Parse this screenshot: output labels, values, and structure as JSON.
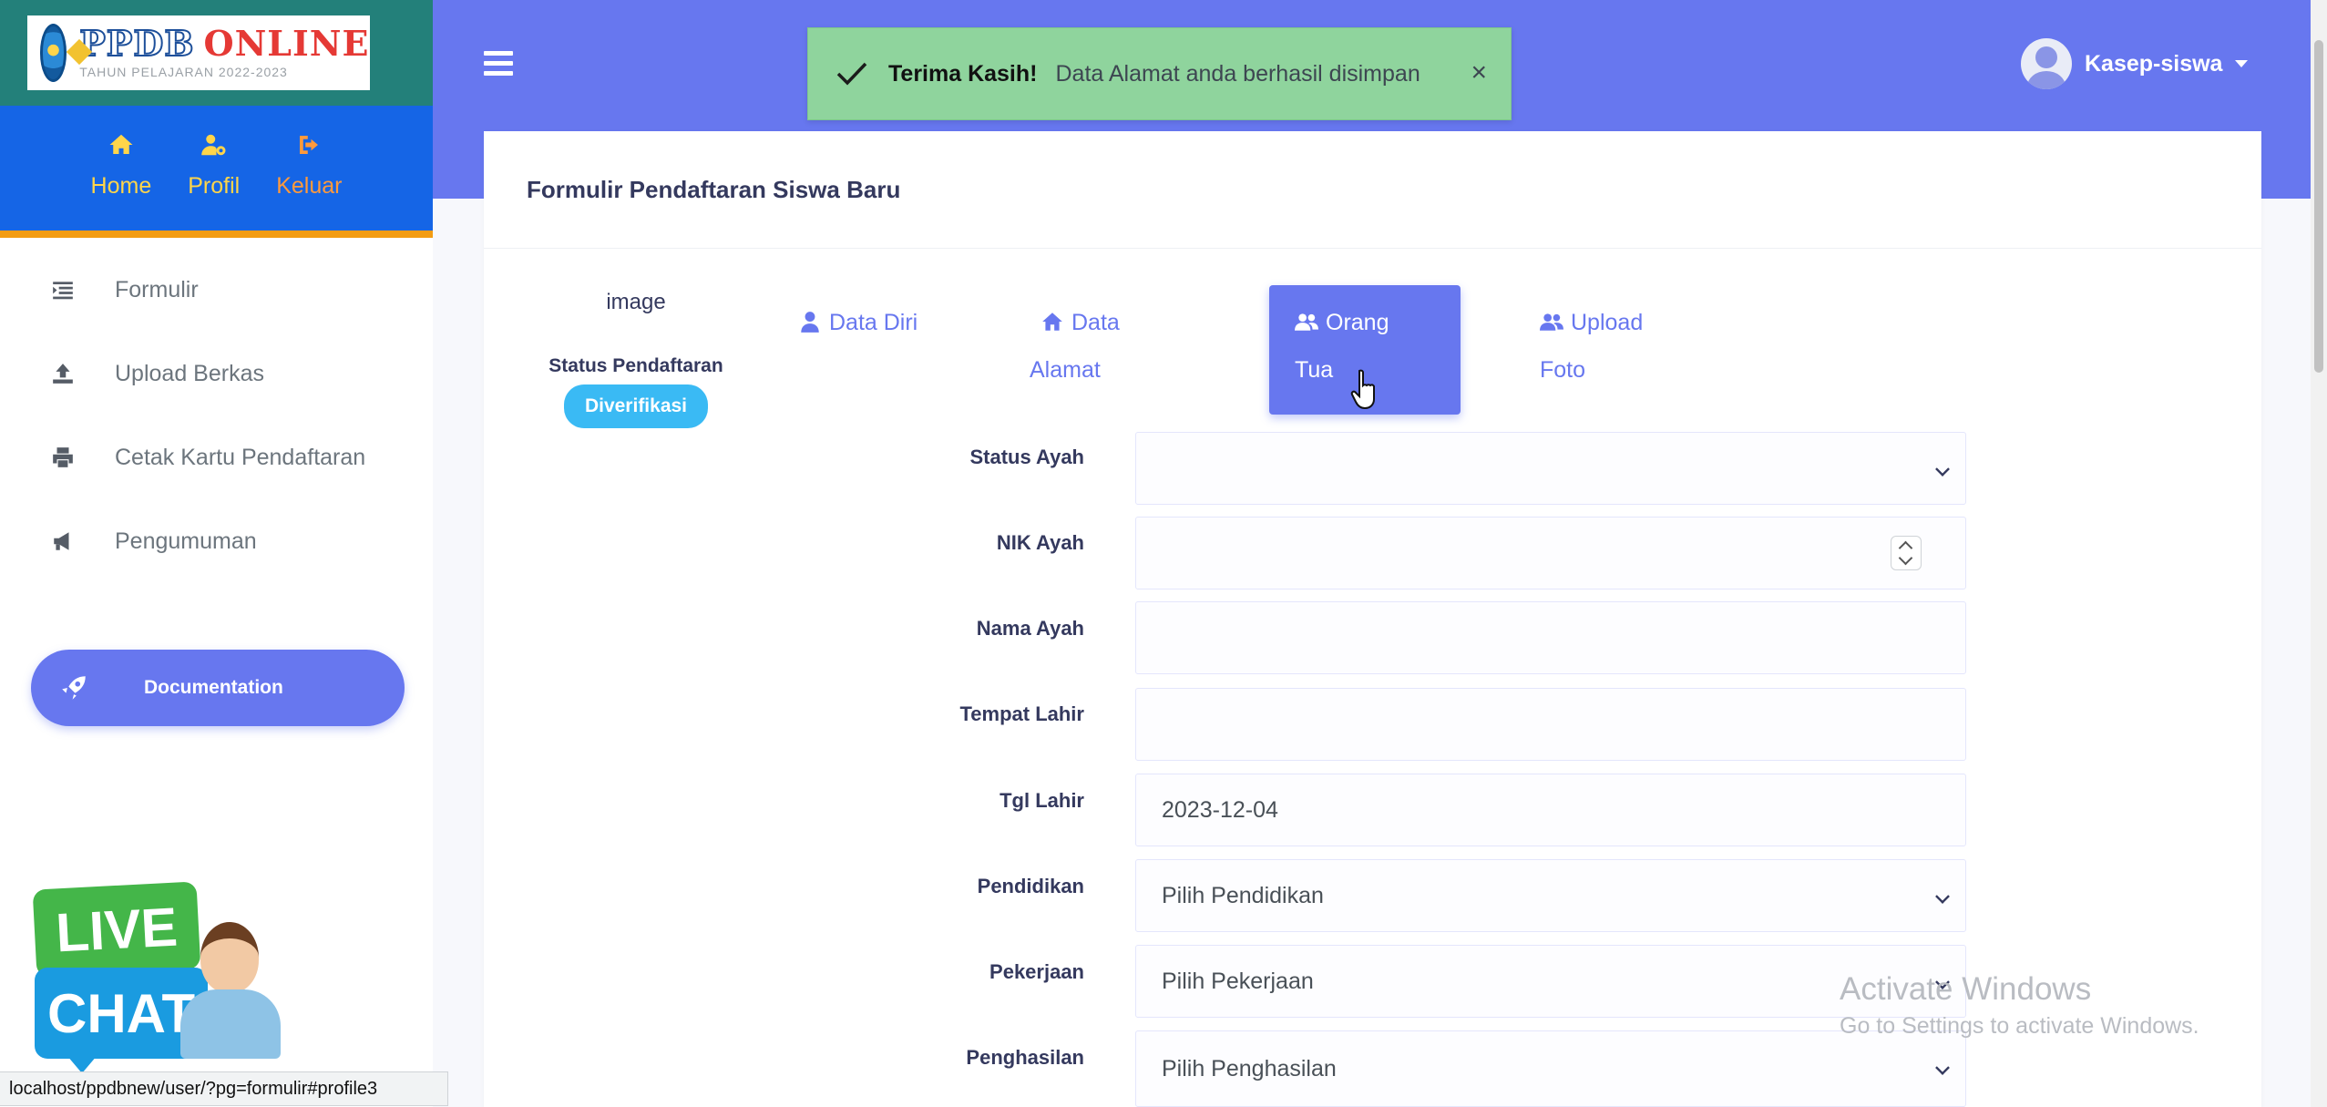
{
  "brand": {
    "title_ppdb": "PPDB",
    "title_online": "ONLINE",
    "subtitle": "TAHUN PELAJARAN 2022-2023"
  },
  "quick_links": [
    {
      "label": "Home",
      "icon": "home-icon"
    },
    {
      "label": "Profil",
      "icon": "user-cog-icon"
    },
    {
      "label": "Keluar",
      "icon": "sign-out-icon"
    }
  ],
  "menu": [
    {
      "label": "Formulir",
      "icon": "list-icon"
    },
    {
      "label": "Upload Berkas",
      "icon": "upload-icon"
    },
    {
      "label": "Cetak Kartu Pendaftaran",
      "icon": "print-icon"
    },
    {
      "label": "Pengumuman",
      "icon": "megaphone-icon"
    }
  ],
  "documentation": {
    "label": "Documentation",
    "icon": "rocket-icon"
  },
  "livechat": {
    "line1": "LIVE",
    "line2": "CHAT"
  },
  "status_bar": {
    "url": "localhost/ppdbnew/user/?pg=formulir#profile3"
  },
  "toast": {
    "strong": "Terima Kasih!",
    "message": "Data Alamat anda berhasil disimpan",
    "close": "×",
    "color": "#8fd49d"
  },
  "user": {
    "name": "Kasep-siswa"
  },
  "card": {
    "title": "Formulir Pendaftaran Siswa Baru"
  },
  "profile": {
    "image_alt": "image",
    "status_label": "Status Pendaftaran",
    "status_badge": "Diverifikasi"
  },
  "tabs": [
    {
      "line1": "Data Diri",
      "line2": "",
      "icon": "user-icon",
      "active": false
    },
    {
      "line1": "Data",
      "line2": "Alamat",
      "icon": "home-icon",
      "active": false
    },
    {
      "line1": "Orang",
      "line2": "Tua",
      "icon": "users-icon",
      "active": true
    },
    {
      "line1": "Upload",
      "line2": "Foto",
      "icon": "users-icon",
      "active": false
    }
  ],
  "form": {
    "status_ayah": {
      "label": "Status Ayah",
      "value": ""
    },
    "nik_ayah": {
      "label": "NIK Ayah",
      "value": ""
    },
    "nama_ayah": {
      "label": "Nama Ayah",
      "value": ""
    },
    "tempat_lahir": {
      "label": "Tempat Lahir",
      "value": ""
    },
    "tgl_lahir": {
      "label": "Tgl Lahir",
      "value": "2023-12-04"
    },
    "pendidikan": {
      "label": "Pendidikan",
      "value": "Pilih Pendidikan"
    },
    "pekerjaan": {
      "label": "Pekerjaan",
      "value": "Pilih Pekerjaan"
    },
    "penghasilan": {
      "label": "Penghasilan",
      "value": "Pilih Penghasilan"
    }
  },
  "windows_watermark": {
    "title": "Activate Windows",
    "subtitle": "Go to Settings to activate Windows."
  },
  "colors": {
    "primary": "#6777ef",
    "sidebar_brand": "#23807a",
    "quick_bar": "#1565e6",
    "accent_border": "#f39c12",
    "badge": "#3abaf4"
  }
}
